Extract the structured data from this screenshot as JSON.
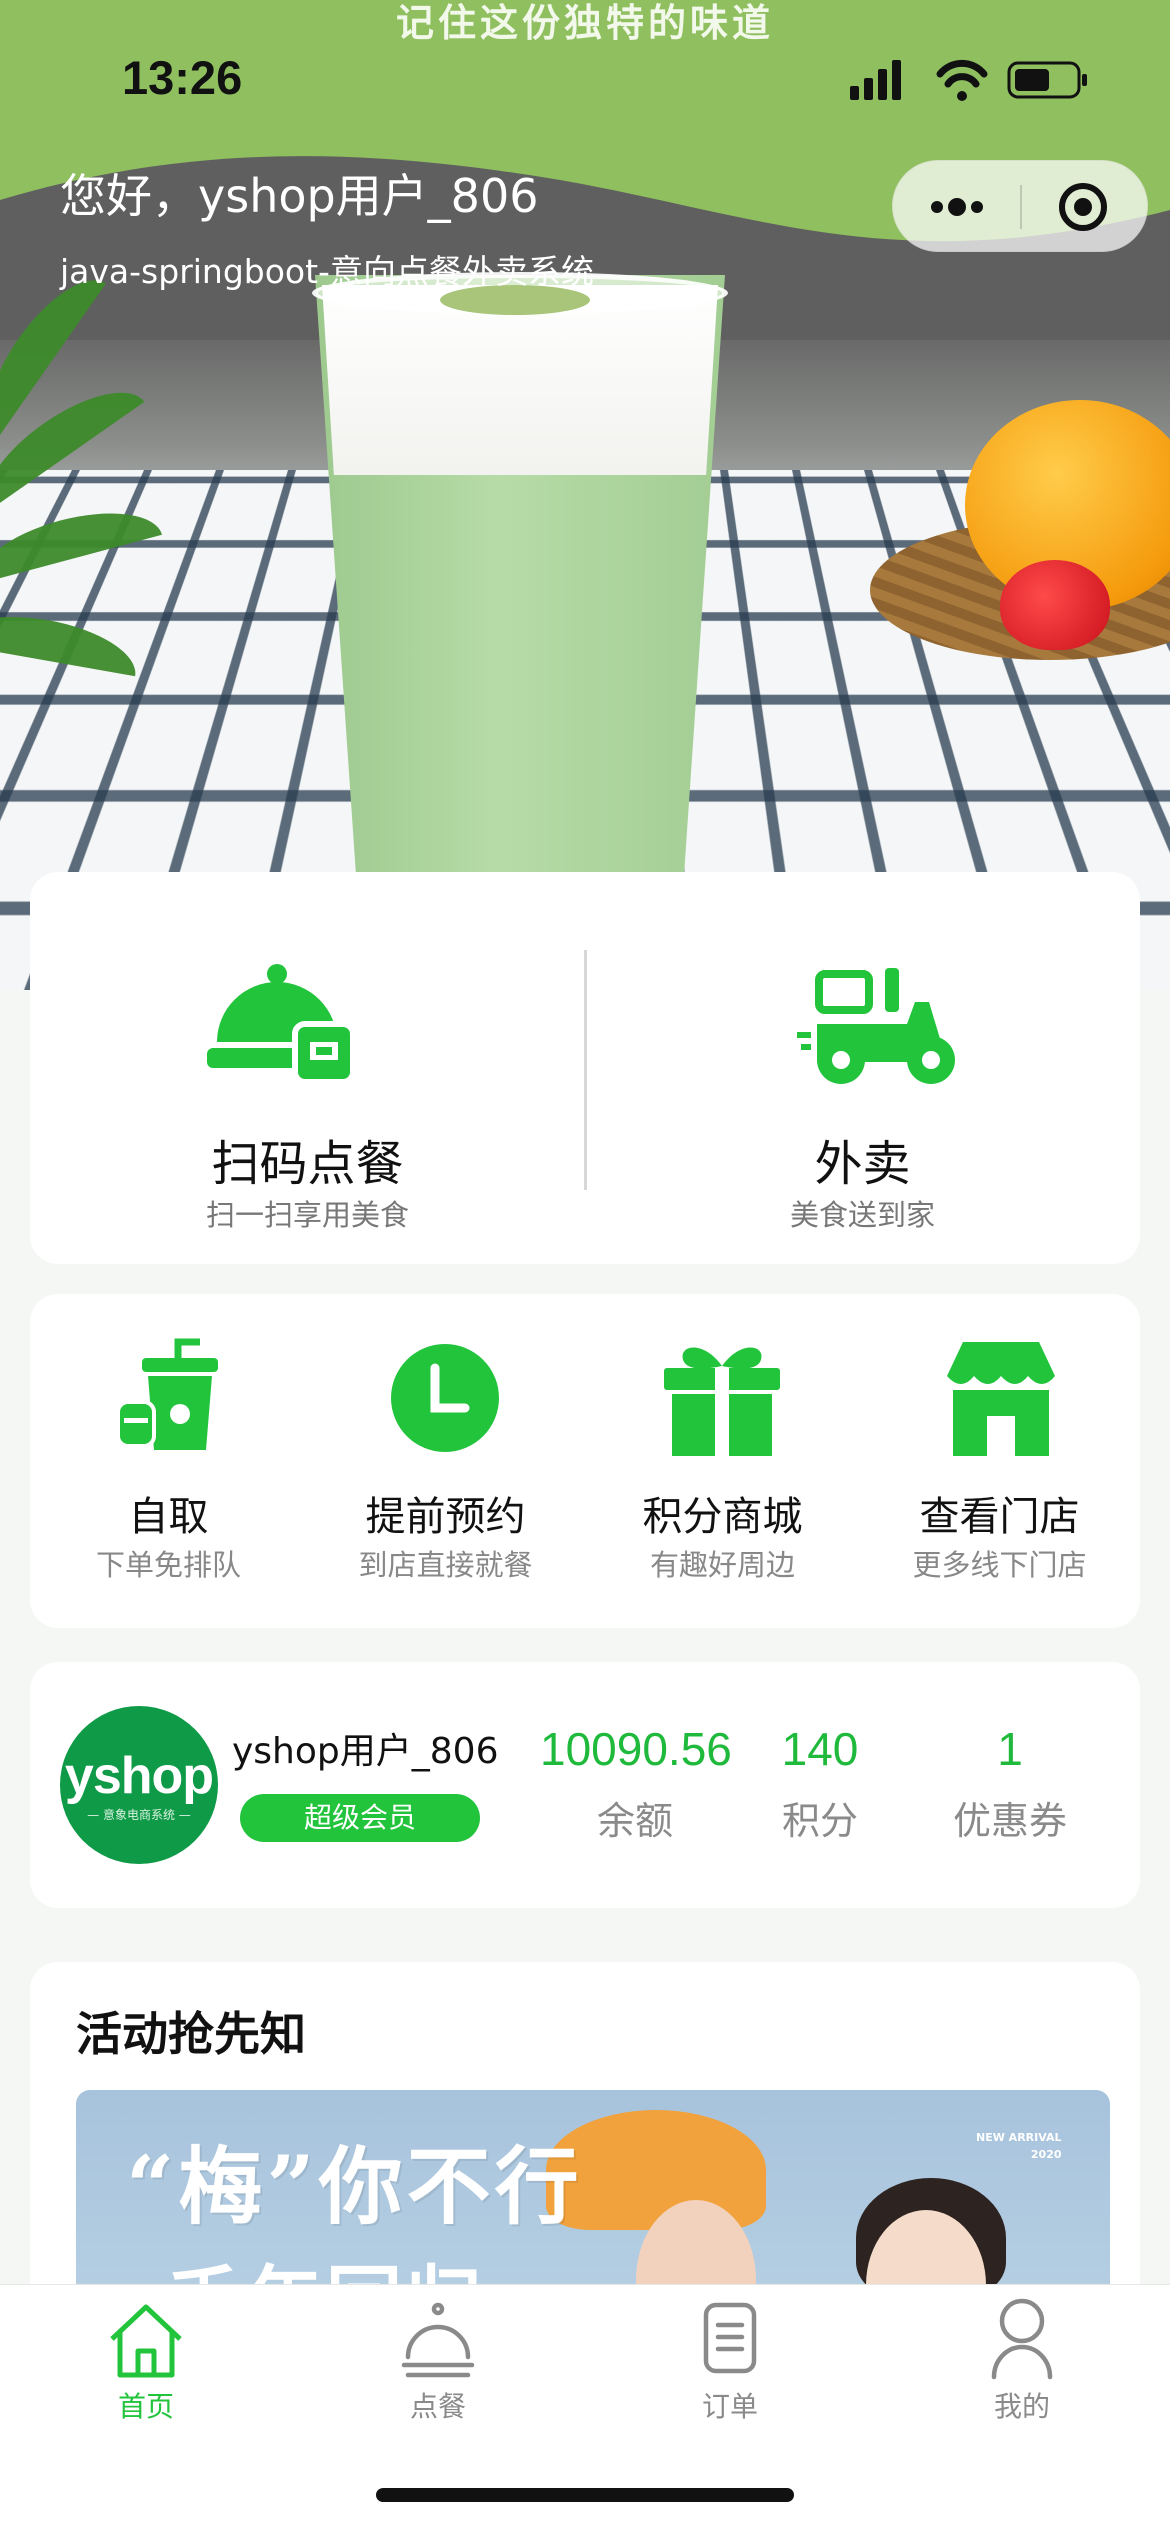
{
  "status_bar": {
    "time": "13:26"
  },
  "hero": {
    "slogan": "记住这份独特的味道",
    "greeting": "您好，yshop用户_806",
    "subtitle": "java-springboot-意向点餐外卖系统"
  },
  "main_actions": [
    {
      "title": "扫码点餐",
      "desc": "扫一扫享用美食",
      "icon": "cloche-icon"
    },
    {
      "title": "外卖",
      "desc": "美食送到家",
      "icon": "scooter-icon"
    }
  ],
  "quick_actions": [
    {
      "title": "自取",
      "desc": "下单免排队",
      "icon": "drink-cup-icon"
    },
    {
      "title": "提前预约",
      "desc": "到店直接就餐",
      "icon": "clock-icon"
    },
    {
      "title": "积分商城",
      "desc": "有趣好周边",
      "icon": "gift-icon"
    },
    {
      "title": "查看门店",
      "desc": "更多线下门店",
      "icon": "store-icon"
    }
  ],
  "member": {
    "avatar_text": "yshop",
    "avatar_sub": "— 意象电商系统 —",
    "name": "yshop用户_806",
    "badge": "超级会员",
    "stats": [
      {
        "value": "10090.56",
        "label": "余额"
      },
      {
        "value": "140",
        "label": "积分"
      },
      {
        "value": "1",
        "label": "优惠券"
      }
    ]
  },
  "activity": {
    "title": "活动抢先知",
    "banner_title": "“梅”你不行",
    "banner_sub": "千年回归",
    "banner_tag_line1": "NEW ARRIVAL",
    "banner_tag_line2": "2020"
  },
  "tabbar": [
    {
      "label": "首页",
      "icon": "home-icon",
      "active": true
    },
    {
      "label": "点餐",
      "icon": "cloche-icon",
      "active": false
    },
    {
      "label": "订单",
      "icon": "order-list-icon",
      "active": false
    },
    {
      "label": "我的",
      "icon": "user-icon",
      "active": false
    }
  ],
  "colors": {
    "accent": "#22c43c",
    "stat_green": "#1fb93c",
    "avatar_green": "#0f9a47"
  }
}
